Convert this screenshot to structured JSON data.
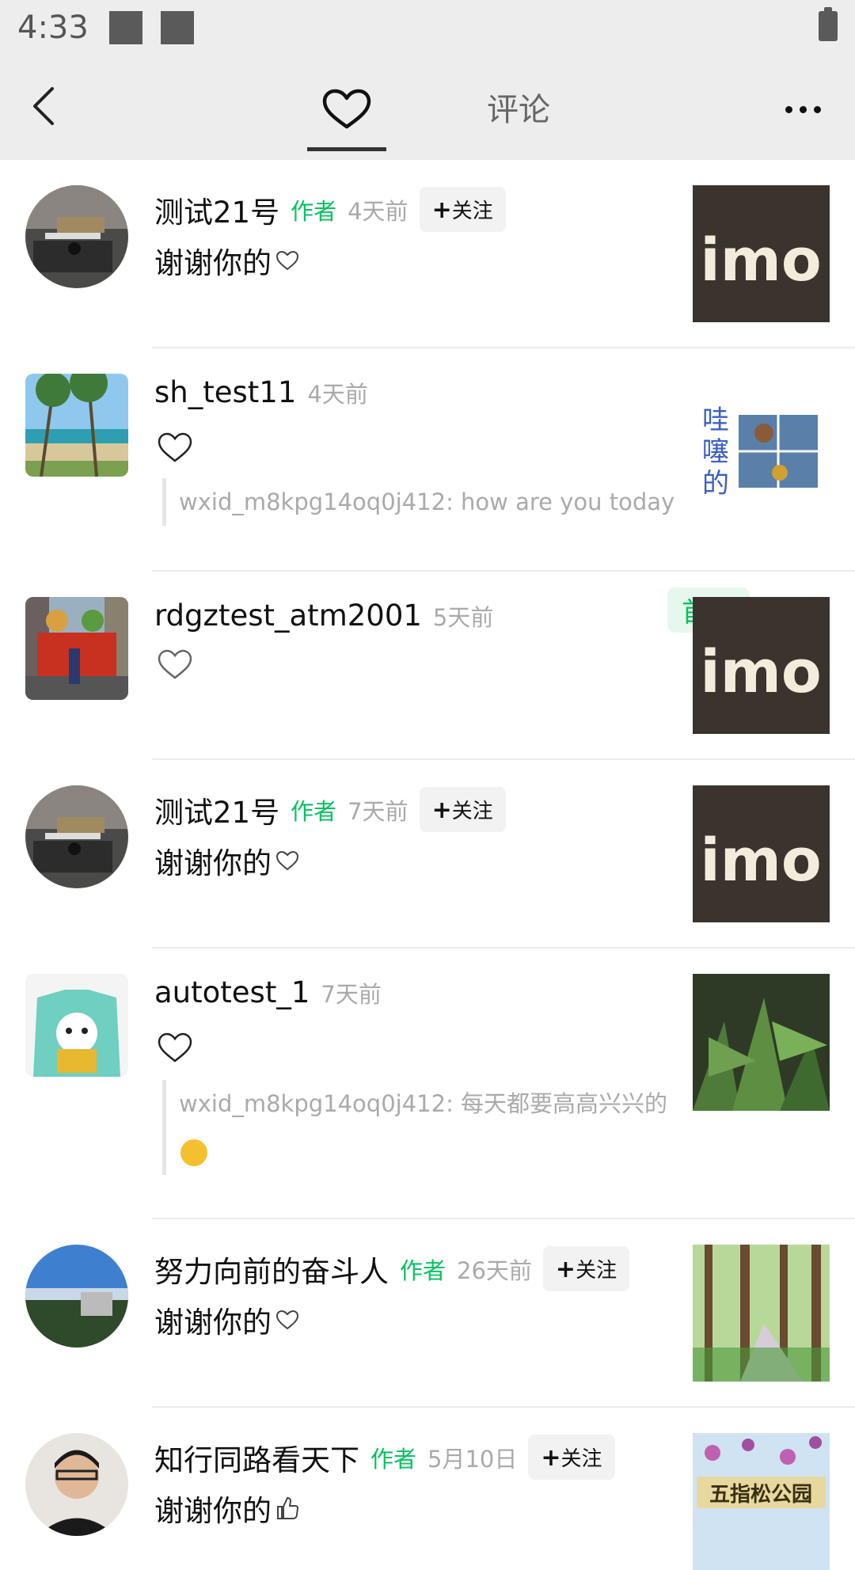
{
  "status_bar": {
    "time": "4:33"
  },
  "header": {
    "tab_comment": "评论"
  },
  "items": [
    {
      "name": "测试21号",
      "role": "作者",
      "time": "4天前",
      "follow": "关注",
      "text": "谢谢你的"
    },
    {
      "name": "sh_test11",
      "time": "4天前",
      "quote": "wxid_m8kpg14oq0j412: how are you today"
    },
    {
      "name": "rdgztest_atm2001",
      "time": "5天前",
      "badge": "首赞"
    },
    {
      "name": "测试21号",
      "role": "作者",
      "time": "7天前",
      "follow": "关注",
      "text": "谢谢你的"
    },
    {
      "name": "autotest_1",
      "time": "7天前",
      "quote": "wxid_m8kpg14oq0j412: 每天都要高高兴兴的"
    },
    {
      "name": "努力向前的奋斗人",
      "role": "作者",
      "time": "26天前",
      "follow": "关注",
      "text": "谢谢你的"
    },
    {
      "name": "知行同路看天下",
      "role": "作者",
      "time": "5月10日",
      "follow": "关注",
      "text": "谢谢你的"
    }
  ],
  "thumb_text": {
    "imo": "imo",
    "park": "五指松公园"
  },
  "colors": {
    "accent": "#07c160",
    "header_bg": "#ededed"
  }
}
